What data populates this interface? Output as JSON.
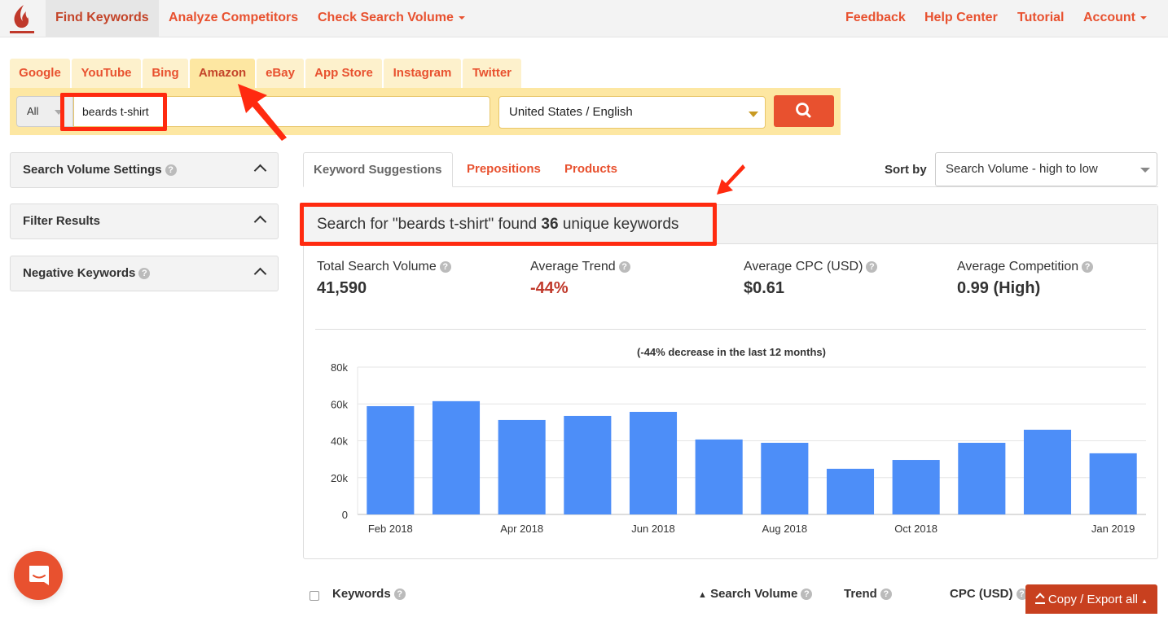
{
  "topnav": {
    "left": [
      {
        "label": "Find Keywords",
        "active": true
      },
      {
        "label": "Analyze Competitors",
        "active": false
      },
      {
        "label": "Check Search Volume",
        "dropdown": true
      }
    ],
    "right": [
      {
        "label": "Feedback"
      },
      {
        "label": "Help Center"
      },
      {
        "label": "Tutorial"
      },
      {
        "label": "Account",
        "dropdown": true
      }
    ],
    "logo_icon": "flame-logo-icon"
  },
  "platform_tabs": [
    {
      "label": "Google"
    },
    {
      "label": "YouTube"
    },
    {
      "label": "Bing"
    },
    {
      "label": "Amazon",
      "active": true
    },
    {
      "label": "eBay"
    },
    {
      "label": "App Store"
    },
    {
      "label": "Instagram"
    },
    {
      "label": "Twitter"
    }
  ],
  "search": {
    "type_label": "All",
    "query": "beards t-shirt",
    "location_language": "United States / English",
    "button_icon": "search-icon"
  },
  "sidebar": {
    "panels": [
      {
        "label": "Search Volume Settings",
        "help": true
      },
      {
        "label": "Filter Results",
        "help": false
      },
      {
        "label": "Negative Keywords",
        "help": true
      }
    ]
  },
  "result_tabs": [
    {
      "label": "Keyword Suggestions",
      "active": true
    },
    {
      "label": "Prepositions"
    },
    {
      "label": "Products"
    }
  ],
  "sort": {
    "label": "Sort by",
    "value": "Search Volume - high to low"
  },
  "summary": {
    "prefix": "Search for \"beards t-shirt\" found ",
    "count": "36",
    "suffix": " unique keywords"
  },
  "stats": [
    {
      "label": "Total Search Volume",
      "value": "41,590"
    },
    {
      "label": "Average Trend",
      "value": "-44%"
    },
    {
      "label": "Average CPC (USD)",
      "value": "$0.61"
    },
    {
      "label": "Average Competition",
      "value": "0.99 (High)"
    }
  ],
  "colors": {
    "accent": "#e8512f",
    "bar": "#4d8ef8",
    "negative": "#c0392b",
    "annotation": "#ff2a0f"
  },
  "chart_data": {
    "type": "bar",
    "title": "(-44% decrease in the last 12 months)",
    "categories": [
      "Feb 2018",
      "Mar 2018",
      "Apr 2018",
      "May 2018",
      "Jun 2018",
      "Jul 2018",
      "Aug 2018",
      "Sep 2018",
      "Oct 2018",
      "Nov 2018",
      "Dec 2018",
      "Jan 2019"
    ],
    "values": [
      58800,
      61500,
      51300,
      53500,
      55700,
      40700,
      38900,
      24800,
      29600,
      38900,
      46000,
      33200
    ],
    "x_tick_labels": [
      "Feb 2018",
      "",
      "Apr 2018",
      "",
      "Jun 2018",
      "",
      "Aug 2018",
      "",
      "Oct 2018",
      "",
      "",
      "Jan 2019"
    ],
    "y_ticks": [
      0,
      20000,
      40000,
      60000,
      80000
    ],
    "y_tick_labels": [
      "0",
      "20k",
      "40k",
      "60k",
      "80k"
    ],
    "ylim": [
      0,
      80000
    ],
    "xlabel": "",
    "ylabel": "",
    "grid": true,
    "legend": "none"
  },
  "table_header": {
    "columns": [
      {
        "label": "Keywords",
        "help": true
      },
      {
        "label": "Search Volume",
        "help": true,
        "sorted": "asc-indicator"
      },
      {
        "label": "Trend",
        "help": true
      },
      {
        "label": "CPC (USD)",
        "help": true
      }
    ],
    "export_label": "Copy / Export all"
  },
  "chat_widget_icon": "chat-icon"
}
